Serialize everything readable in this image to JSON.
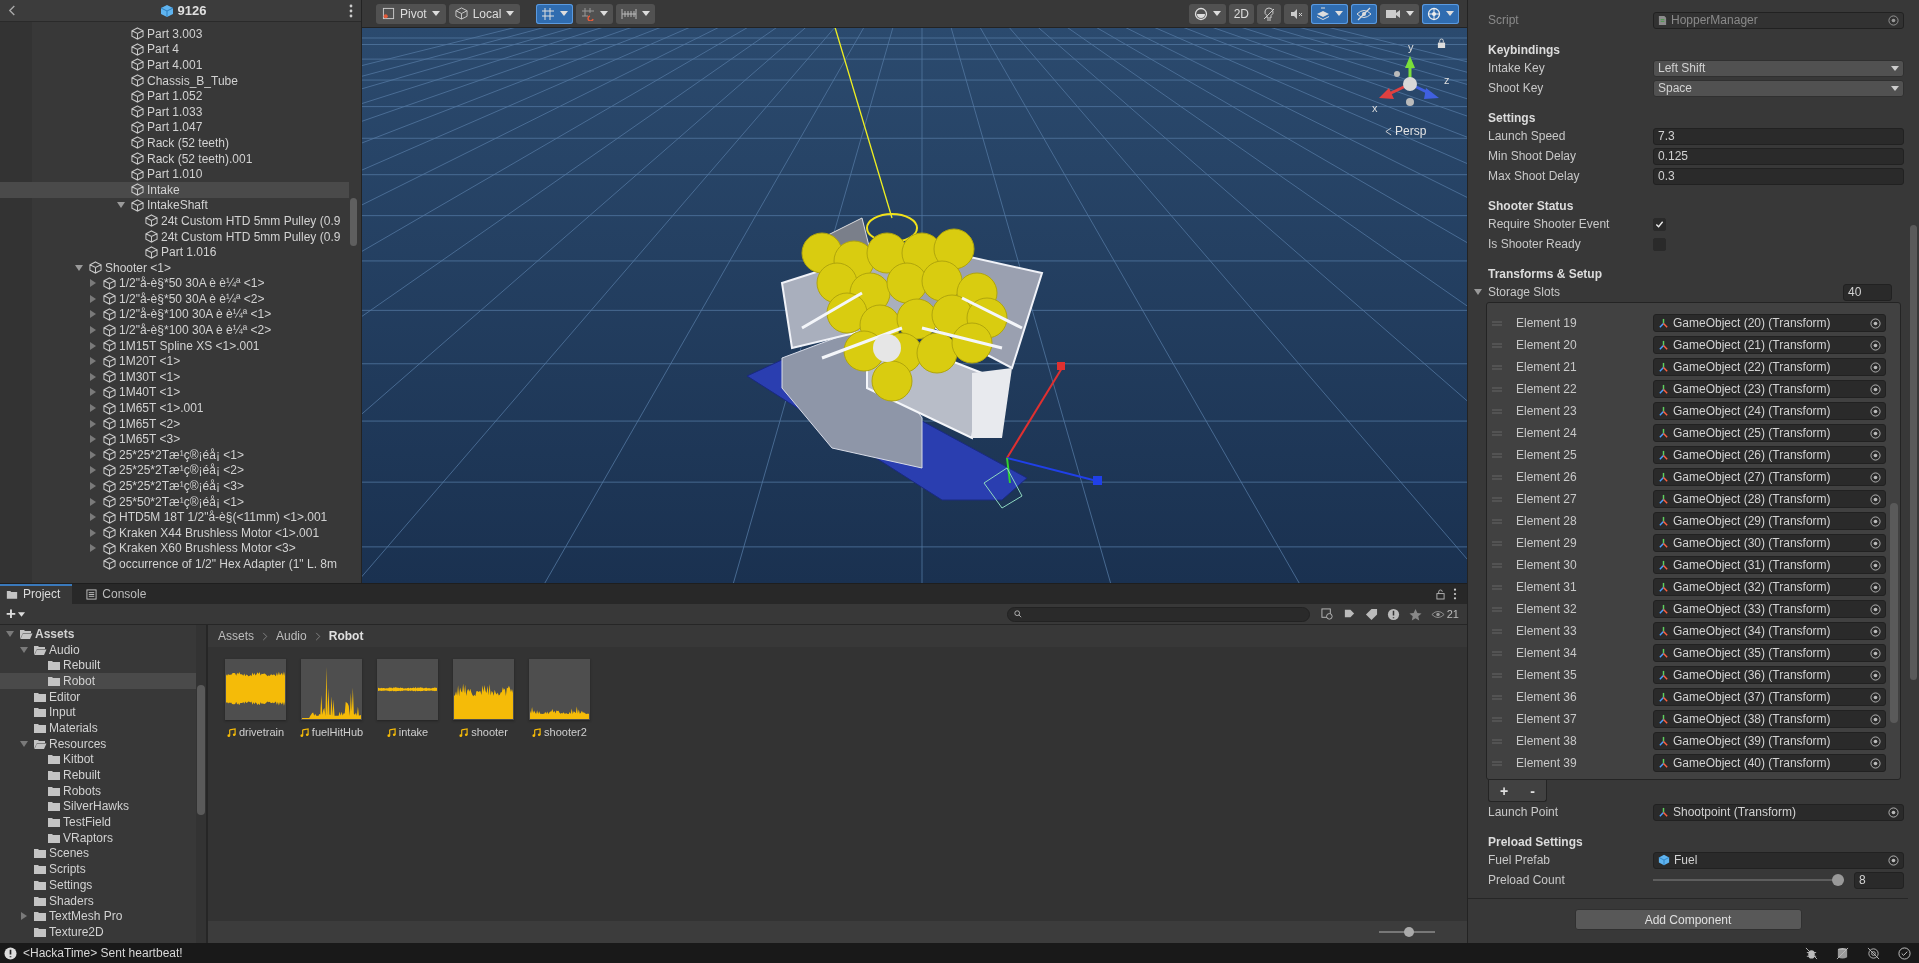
{
  "hierarchy": {
    "title": "9126",
    "tree": [
      {
        "children": [
          {
            "children": [
              {
                "children": [
                  {
                    "name": "Part 3.003",
                    "selected": false
                  },
                  {
                    "name": "Part 4",
                    "selected": false
                  },
                  {
                    "name": "Part 4.001",
                    "selected": false
                  },
                  {
                    "name": "Chassis_B_Tube",
                    "selected": false
                  },
                  {
                    "name": "Part 1.052",
                    "selected": false
                  },
                  {
                    "name": "Part 1.033",
                    "selected": false
                  },
                  {
                    "name": "Part 1.047",
                    "selected": false
                  },
                  {
                    "name": "Rack (52 teeth)",
                    "selected": false
                  },
                  {
                    "name": "Rack (52 teeth).001",
                    "selected": false
                  },
                  {
                    "name": "Part 1.010",
                    "selected": false
                  },
                  {
                    "name": "Intake",
                    "selected": true
                  },
                  {
                    "name": "IntakeShaft",
                    "selected": false,
                    "expanded": true,
                    "children": [
                      {
                        "name": "24t Custom HTD 5mm Pulley (0.9",
                        "selected": false
                      },
                      {
                        "name": "24t Custom HTD 5mm Pulley (0.9",
                        "selected": false
                      },
                      {
                        "name": "Part 1.016",
                        "selected": false
                      }
                    ]
                  }
                ]
              }
            ]
          }
        ]
      },
      {
        "name": "Shooter <1>",
        "selected": false,
        "expanded": true,
        "children": [
          {
            "name": "1/2\"å-è§*50 30A è è¼ª <1>",
            "selected": false,
            "expanded": false
          },
          {
            "name": "1/2\"å-è§*50 30A è è¼ª <2>",
            "selected": false,
            "expanded": false
          },
          {
            "name": "1/2\"å-è§*100 30A è è¼ª <1>",
            "selected": false,
            "expanded": false
          },
          {
            "name": "1/2\"å-è§*100 30A è è¼ª <2>",
            "selected": false,
            "expanded": false
          },
          {
            "name": "1M15T Spline XS <1>.001",
            "selected": false,
            "expanded": false
          },
          {
            "name": "1M20T <1>",
            "selected": false,
            "expanded": false
          },
          {
            "name": "1M30T <1>",
            "selected": false,
            "expanded": false
          },
          {
            "name": "1M40T <1>",
            "selected": false,
            "expanded": false
          },
          {
            "name": "1M65T <1>.001",
            "selected": false,
            "expanded": false
          },
          {
            "name": "1M65T <2>",
            "selected": false,
            "expanded": false
          },
          {
            "name": "1M65T <3>",
            "selected": false,
            "expanded": false
          },
          {
            "name": "25*25*2Tæ¹ç®¡éå¡ <1>",
            "selected": false,
            "expanded": false
          },
          {
            "name": "25*25*2Tæ¹ç®¡éå¡ <2>",
            "selected": false,
            "expanded": false
          },
          {
            "name": "25*25*2Tæ¹ç®¡éå¡ <3>",
            "selected": false,
            "expanded": false
          },
          {
            "name": "25*50*2Tæ¹ç®¡éå¡ <1>",
            "selected": false,
            "expanded": false
          },
          {
            "name": "HTD5M 18T  1/2\"å-è§(<11mm) <1>.001",
            "selected": false,
            "expanded": false
          },
          {
            "name": "Kraken X44 Brushless Motor <1>.001",
            "selected": false,
            "expanded": false
          },
          {
            "name": "Kraken X60 Brushless Motor <3>",
            "selected": false,
            "expanded": false
          },
          {
            "name": "occurrence of 1/2\" Hex Adapter (1\" L. 8m",
            "selected": false
          }
        ]
      }
    ]
  },
  "scene": {
    "handle_buttons": [
      {
        "kind": "pivot",
        "label": "Pivot"
      },
      {
        "kind": "local",
        "label": "Local"
      }
    ],
    "snap_buttons": [
      {
        "kind": "grid",
        "selected": true
      },
      {
        "kind": "snap",
        "selected": false
      },
      {
        "kind": "increment",
        "selected": false
      }
    ],
    "view_buttons": [
      {
        "kind": "shading",
        "selected": false
      },
      {
        "kind": "flat",
        "label": "2D",
        "selected": false
      },
      {
        "kind": "light",
        "selected": false
      },
      {
        "kind": "audio",
        "selected": false
      },
      {
        "kind": "effects",
        "selected": true
      },
      {
        "kind": "visibility",
        "selected": true
      },
      {
        "kind": "camera",
        "selected": false
      },
      {
        "kind": "gizmos",
        "selected": true
      }
    ],
    "axis_gizmo": {
      "y": "y",
      "x": "x",
      "z": "z",
      "projection": "Persp"
    }
  },
  "inspector": {
    "script": {
      "label": "Script",
      "value": "HopperManager",
      "disabled": true
    },
    "sections": [
      {
        "heading": "Keybindings",
        "fields": [
          {
            "kind": "dropdown",
            "label": "Intake Key",
            "value": "Left Shift"
          },
          {
            "kind": "dropdown",
            "label": "Shoot Key",
            "value": "Space"
          }
        ]
      },
      {
        "heading": "Settings",
        "fields": [
          {
            "kind": "number",
            "label": "Launch Speed",
            "value": "7.3"
          },
          {
            "kind": "number",
            "label": "Min Shoot Delay",
            "value": "0.125"
          },
          {
            "kind": "number",
            "label": "Max Shoot Delay",
            "value": "0.3"
          }
        ]
      },
      {
        "heading": "Shooter Status",
        "fields": [
          {
            "kind": "checkbox",
            "label": "Require Shooter Event",
            "checked": true
          },
          {
            "kind": "checkbox",
            "label": "Is Shooter Ready",
            "checked": false
          }
        ]
      },
      {
        "heading": "Transforms & Setup",
        "fields": [
          {
            "kind": "list",
            "label": "Storage Slots",
            "count": "40",
            "expanded": true,
            "add": "+",
            "remove": "-",
            "elements": [
              {
                "label": "Element 19",
                "value": "GameObject (20) (Transform)"
              },
              {
                "label": "Element 20",
                "value": "GameObject (21) (Transform)"
              },
              {
                "label": "Element 21",
                "value": "GameObject (22) (Transform)"
              },
              {
                "label": "Element 22",
                "value": "GameObject (23) (Transform)"
              },
              {
                "label": "Element 23",
                "value": "GameObject (24) (Transform)"
              },
              {
                "label": "Element 24",
                "value": "GameObject (25) (Transform)"
              },
              {
                "label": "Element 25",
                "value": "GameObject (26) (Transform)"
              },
              {
                "label": "Element 26",
                "value": "GameObject (27) (Transform)"
              },
              {
                "label": "Element 27",
                "value": "GameObject (28) (Transform)"
              },
              {
                "label": "Element 28",
                "value": "GameObject (29) (Transform)"
              },
              {
                "label": "Element 29",
                "value": "GameObject (30) (Transform)"
              },
              {
                "label": "Element 30",
                "value": "GameObject (31) (Transform)"
              },
              {
                "label": "Element 31",
                "value": "GameObject (32) (Transform)"
              },
              {
                "label": "Element 32",
                "value": "GameObject (33) (Transform)"
              },
              {
                "label": "Element 33",
                "value": "GameObject (34) (Transform)"
              },
              {
                "label": "Element 34",
                "value": "GameObject (35) (Transform)"
              },
              {
                "label": "Element 35",
                "value": "GameObject (36) (Transform)"
              },
              {
                "label": "Element 36",
                "value": "GameObject (37) (Transform)"
              },
              {
                "label": "Element 37",
                "value": "GameObject (38) (Transform)"
              },
              {
                "label": "Element 38",
                "value": "GameObject (39) (Transform)"
              },
              {
                "label": "Element 39",
                "value": "GameObject (40) (Transform)"
              }
            ]
          },
          {
            "kind": "transform",
            "label": "Launch Point",
            "value": "Shootpoint (Transform)"
          }
        ]
      },
      {
        "heading": "Preload Settings",
        "fields": [
          {
            "kind": "prefab",
            "label": "Fuel Prefab",
            "value": "Fuel"
          },
          {
            "kind": "slider",
            "label": "Preload Count",
            "level": 1,
            "value": "8"
          }
        ]
      }
    ],
    "add_component": "Add Component"
  },
  "project": {
    "tabs": [
      {
        "label": "Project",
        "selected": true
      },
      {
        "label": "Console",
        "selected": false
      }
    ],
    "add": "+",
    "item_count": "21",
    "folders": [
      {
        "name": "Assets",
        "selected": false,
        "expanded": true,
        "children": [
          {
            "name": "Audio",
            "selected": false,
            "expanded": true,
            "children": [
              {
                "name": "Rebuilt",
                "selected": false
              },
              {
                "name": "Robot",
                "selected": true
              }
            ]
          },
          {
            "name": "Editor",
            "selected": false
          },
          {
            "name": "Input",
            "selected": false
          },
          {
            "name": "Materials",
            "selected": false
          },
          {
            "name": "Resources",
            "selected": false,
            "expanded": true,
            "children": [
              {
                "name": "Kitbot",
                "selected": false
              },
              {
                "name": "Rebuilt",
                "selected": false
              },
              {
                "name": "Robots",
                "selected": false
              },
              {
                "name": "SilverHawks",
                "selected": false
              },
              {
                "name": "TestField",
                "selected": false
              },
              {
                "name": "VRaptors",
                "selected": false
              }
            ]
          },
          {
            "name": "Scenes",
            "selected": false
          },
          {
            "name": "Scripts",
            "selected": false
          },
          {
            "name": "Settings",
            "selected": false
          },
          {
            "name": "Shaders",
            "selected": false
          },
          {
            "name": "TextMesh Pro",
            "selected": false,
            "expanded": false
          },
          {
            "name": "Texture2D",
            "selected": false
          }
        ]
      }
    ],
    "breadcrumb": [
      "Assets",
      "Audio",
      "Robot"
    ],
    "assets": [
      {
        "name": "drivetrain"
      },
      {
        "name": "fuelHitHub"
      },
      {
        "name": "intake"
      },
      {
        "name": "shooter"
      },
      {
        "name": "shooter2"
      }
    ],
    "zoom": {
      "level": 0.55
    }
  },
  "status_bar": {
    "message": "<HackaTime> Sent heartbeat!"
  }
}
